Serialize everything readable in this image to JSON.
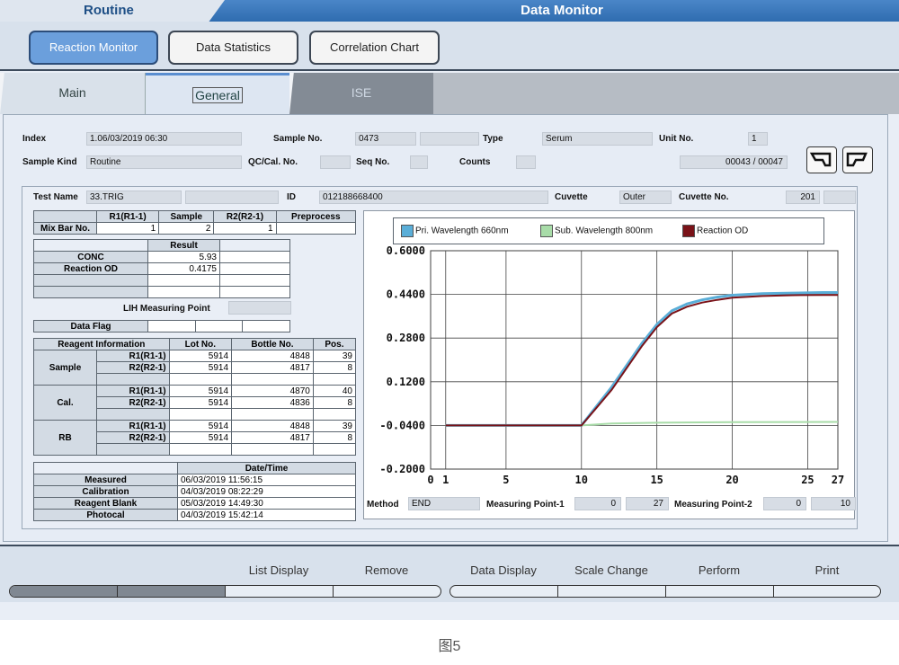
{
  "titlebar": {
    "left": "Routine",
    "right": "Data Monitor"
  },
  "top_buttons": [
    "Reaction Monitor",
    "Data Statistics",
    "Correlation Chart"
  ],
  "tabs": [
    "Main",
    "General",
    "ISE"
  ],
  "info": {
    "index_label": "Index",
    "index_value": "1.06/03/2019 06:30",
    "sample_no_label": "Sample No.",
    "sample_no_value": "0473",
    "type_label": "Type",
    "type_value": "Serum",
    "unit_no_label": "Unit No.",
    "unit_no_value": "1",
    "sample_kind_label": "Sample Kind",
    "sample_kind_value": "Routine",
    "qc_label": "QC/Cal. No.",
    "seq_label": "Seq No.",
    "counts_label": "Counts",
    "position_value": "00043 / 00047"
  },
  "test": {
    "name_label": "Test Name",
    "name_value": "33.TRIG",
    "id_label": "ID",
    "id_value": "012188668400",
    "cuvette_label": "Cuvette",
    "cuvette_value": "Outer",
    "cuvette_no_label": "Cuvette No.",
    "cuvette_no_value": "201"
  },
  "mixbar": {
    "headers": [
      "",
      "R1(R1-1)",
      "Sample",
      "R2(R2-1)",
      "Preprocess"
    ],
    "row_label": "Mix Bar No.",
    "values": [
      "1",
      "2",
      "1",
      ""
    ]
  },
  "result": {
    "header": "Result",
    "conc_label": "CONC",
    "conc_value": "5.93",
    "od_label": "Reaction OD",
    "od_value": "0.4175"
  },
  "lih_label": "LIH Measuring Point",
  "data_flag_label": "Data Flag",
  "reagent": {
    "headers": [
      "Reagent Information",
      "Lot No.",
      "Bottle No.",
      "Pos."
    ],
    "groups": [
      {
        "name": "Sample",
        "rows": [
          [
            "R1(R1-1)",
            "5914",
            "4848",
            "39"
          ],
          [
            "R2(R2-1)",
            "5914",
            "4817",
            "8"
          ]
        ]
      },
      {
        "name": "Cal.",
        "rows": [
          [
            "R1(R1-1)",
            "5914",
            "4870",
            "40"
          ],
          [
            "R2(R2-1)",
            "5914",
            "4836",
            "8"
          ]
        ]
      },
      {
        "name": "RB",
        "rows": [
          [
            "R1(R1-1)",
            "5914",
            "4848",
            "39"
          ],
          [
            "R2(R2-1)",
            "5914",
            "4817",
            "8"
          ]
        ]
      }
    ]
  },
  "datetime": {
    "header": "Date/Time",
    "rows": [
      [
        "Measured",
        "06/03/2019 11:56:15"
      ],
      [
        "Calibration",
        "04/03/2019 08:22:29"
      ],
      [
        "Reagent Blank",
        "05/03/2019 14:49:30"
      ],
      [
        "Photocal",
        "04/03/2019 15:42:14"
      ]
    ]
  },
  "chart_data": {
    "type": "line",
    "x_ticks": [
      "0",
      "1",
      "5",
      "10",
      "15",
      "20",
      "25",
      "27"
    ],
    "y_ticks": [
      "0.6000",
      "0.4400",
      "0.2800",
      "0.1200",
      "-0.0400",
      "-0.2000"
    ],
    "xlim": [
      0,
      27
    ],
    "ylim": [
      -0.2,
      0.6
    ],
    "grid": true,
    "legend_position": "top",
    "series": [
      {
        "name": "Pri. Wavelength 660nm",
        "color": "#5aaed8",
        "x": [
          1,
          10,
          11,
          12,
          13,
          14,
          15,
          16,
          17,
          18,
          19,
          20,
          22,
          24,
          26,
          27
        ],
        "y": [
          -0.04,
          -0.04,
          0.03,
          0.1,
          0.18,
          0.26,
          0.33,
          0.38,
          0.405,
          0.42,
          0.43,
          0.437,
          0.443,
          0.445,
          0.447,
          0.447
        ]
      },
      {
        "name": "Sub. Wavelength 800nm",
        "color": "#a8dca8",
        "x": [
          1,
          10,
          12,
          15,
          20,
          27
        ],
        "y": [
          -0.04,
          -0.04,
          -0.033,
          -0.03,
          -0.028,
          -0.027
        ]
      },
      {
        "name": "Reaction OD",
        "color": "#7a1218",
        "x": [
          1,
          10,
          11,
          12,
          13,
          14,
          15,
          16,
          17,
          18,
          19,
          20,
          22,
          24,
          26,
          27
        ],
        "y": [
          -0.04,
          -0.04,
          0.025,
          0.09,
          0.17,
          0.25,
          0.32,
          0.37,
          0.395,
          0.41,
          0.42,
          0.428,
          0.434,
          0.437,
          0.438,
          0.438
        ]
      }
    ]
  },
  "method": {
    "label": "Method",
    "value": "END",
    "mp1_label": "Measuring Point-1",
    "mp1_a": "0",
    "mp1_b": "27",
    "mp2_label": "Measuring Point-2",
    "mp2_a": "0",
    "mp2_b": "10"
  },
  "bottom_buttons": [
    "List Display",
    "Remove",
    "Data Display",
    "Scale Change",
    "Perform",
    "Print"
  ],
  "caption": "图5"
}
